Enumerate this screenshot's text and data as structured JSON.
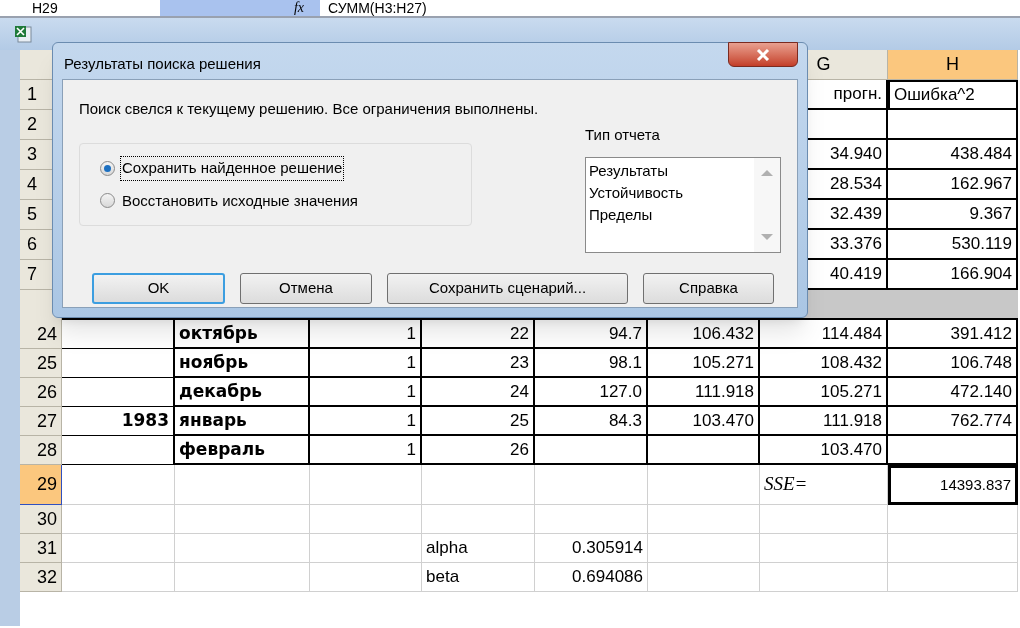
{
  "formula_bar": {
    "name_box": "H29",
    "fx": "fx",
    "formula": "СУММ(H3:H27)"
  },
  "sheet": {
    "visible_column_headers": [
      {
        "label": "G",
        "selected": false
      },
      {
        "label": "H",
        "selected": true
      }
    ],
    "top_rows": [
      {
        "number": "1",
        "g": "прогн.",
        "h": "Ошибка^2"
      },
      {
        "number": "2",
        "g": "",
        "h": ""
      },
      {
        "number": "3",
        "g": "34.940",
        "h": "438.484"
      },
      {
        "number": "4",
        "g": "28.534",
        "h": "162.967"
      },
      {
        "number": "5",
        "g": "32.439",
        "h": "9.367"
      },
      {
        "number": "6",
        "g": "33.376",
        "h": "530.119"
      },
      {
        "number": "7",
        "g": "40.419",
        "h": "166.904"
      }
    ],
    "rows": [
      {
        "number": "24",
        "kind": "data",
        "selected": false,
        "cells": [
          "",
          "октябрь",
          "1",
          "22",
          "94.7",
          "106.432",
          "114.484",
          "391.412"
        ]
      },
      {
        "number": "25",
        "kind": "data",
        "selected": false,
        "cells": [
          "",
          "ноябрь",
          "1",
          "23",
          "98.1",
          "105.271",
          "108.432",
          "106.748"
        ]
      },
      {
        "number": "26",
        "kind": "data",
        "selected": false,
        "cells": [
          "",
          "декабрь",
          "1",
          "24",
          "127.0",
          "111.918",
          "105.271",
          "472.140"
        ]
      },
      {
        "number": "27",
        "kind": "data",
        "selected": false,
        "cells": [
          "1983",
          "январь",
          "1",
          "25",
          "84.3",
          "103.470",
          "111.918",
          "762.774"
        ]
      },
      {
        "number": "28",
        "kind": "data",
        "selected": false,
        "cells": [
          "",
          "февраль",
          "1",
          "26",
          "",
          "",
          "103.470",
          ""
        ]
      },
      {
        "number": "29",
        "kind": "total",
        "selected": true,
        "cells": [
          "",
          "",
          "",
          "",
          "",
          "",
          "SSE=",
          "14393.837"
        ]
      },
      {
        "number": "30",
        "kind": "plain",
        "selected": false,
        "cells": [
          "",
          "",
          "",
          "",
          "",
          "",
          "",
          ""
        ]
      },
      {
        "number": "31",
        "kind": "plain",
        "selected": false,
        "cells": [
          "",
          "",
          "",
          "alpha",
          "0.305914",
          "",
          "",
          ""
        ]
      },
      {
        "number": "32",
        "kind": "plain",
        "selected": false,
        "cells": [
          "",
          "",
          "",
          "beta",
          "0.694086",
          "",
          "",
          ""
        ]
      }
    ]
  },
  "dialog": {
    "title": "Результаты поиска решения",
    "message": "Поиск свелся к текущему решению. Все ограничения выполнены.",
    "options": [
      {
        "label": "Сохранить найденное решение",
        "selected": true
      },
      {
        "label": "Восстановить исходные значения",
        "selected": false
      }
    ],
    "report_type": {
      "label": "Тип отчета",
      "items": [
        "Результаты",
        "Устойчивость",
        "Пределы"
      ]
    },
    "buttons": [
      {
        "label": "OK",
        "default": true
      },
      {
        "label": "Отмена",
        "default": false
      },
      {
        "label": "Сохранить сценарий...",
        "default": false
      },
      {
        "label": "Справка",
        "default": false
      }
    ]
  }
}
